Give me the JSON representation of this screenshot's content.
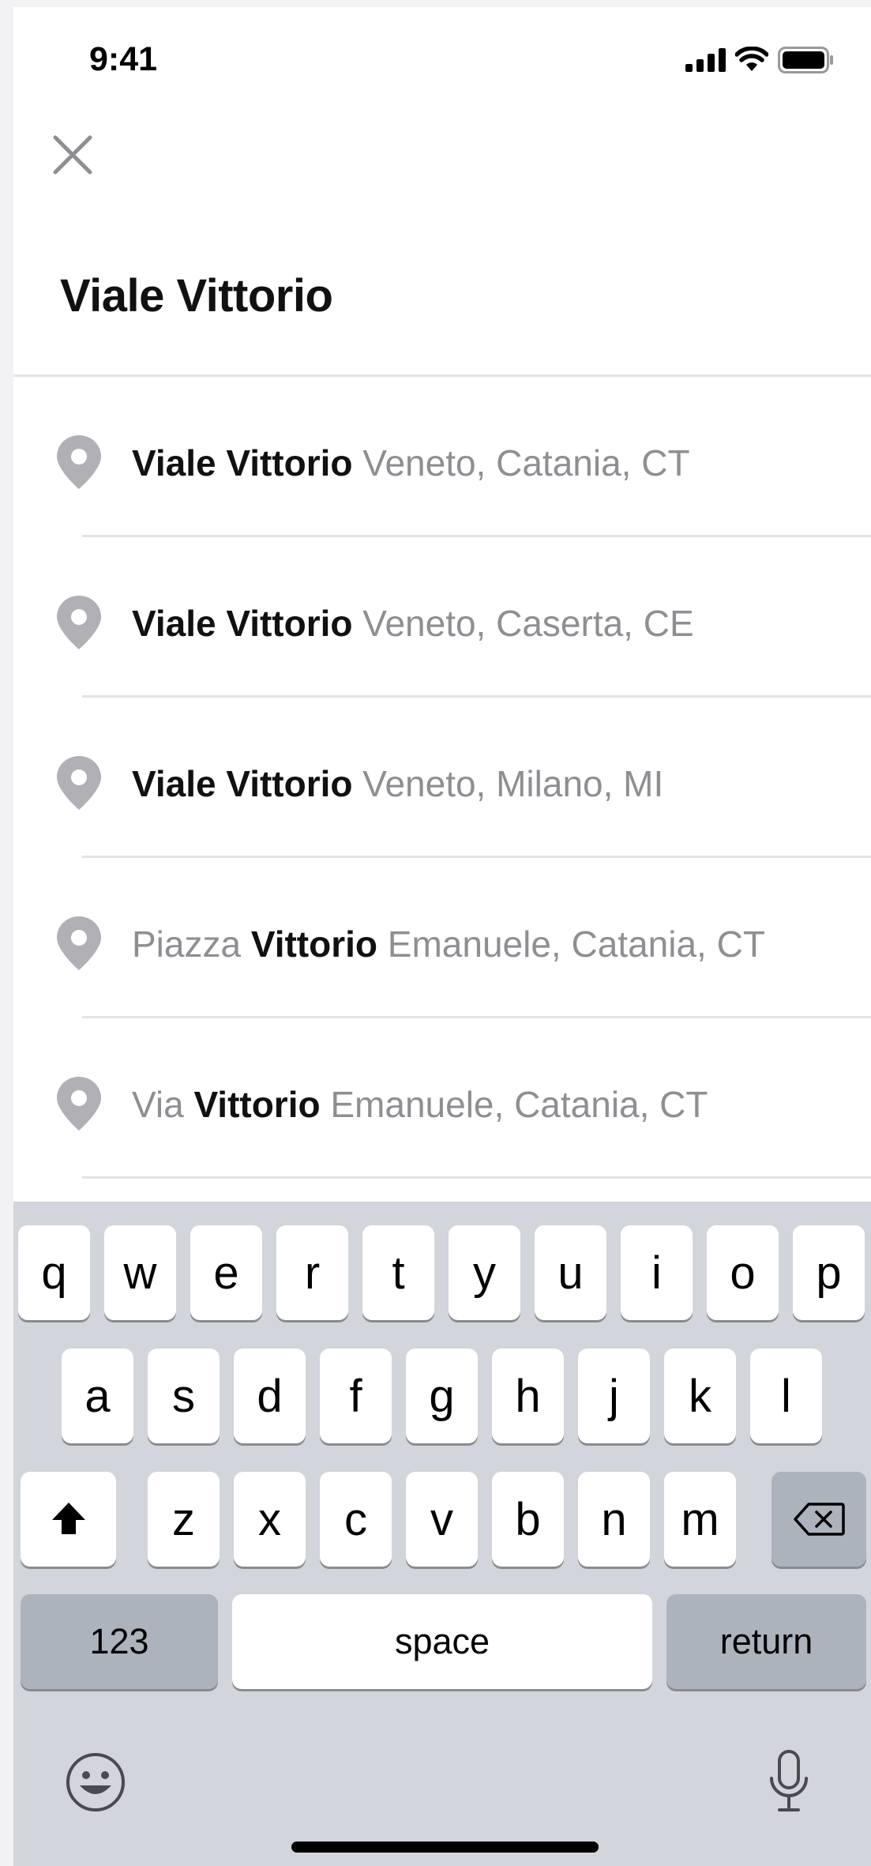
{
  "status_bar": {
    "time": "9:41"
  },
  "search": {
    "query": "Viale Vittorio"
  },
  "results": [
    {
      "prefix": "",
      "bold": "Viale Vittorio",
      "suffix": "Veneto, Catania, CT"
    },
    {
      "prefix": "",
      "bold": "Viale Vittorio",
      "suffix": "Veneto, Caserta, CE"
    },
    {
      "prefix": "",
      "bold": "Viale Vittorio",
      "suffix": "Veneto, Milano, MI"
    },
    {
      "prefix": "Piazza",
      "bold": "Vittorio",
      "suffix": "Emanuele, Catania, CT"
    },
    {
      "prefix": "Via",
      "bold": "Vittorio",
      "suffix": "Emanuele, Catania, CT"
    }
  ],
  "keyboard": {
    "row1": [
      "q",
      "w",
      "e",
      "r",
      "t",
      "y",
      "u",
      "i",
      "o",
      "p"
    ],
    "row2": [
      "a",
      "s",
      "d",
      "f",
      "g",
      "h",
      "j",
      "k",
      "l"
    ],
    "row3": [
      "z",
      "x",
      "c",
      "v",
      "b",
      "n",
      "m"
    ],
    "numbers_label": "123",
    "space_label": "space",
    "return_label": "return"
  },
  "colors": {
    "primary_text": "#111111",
    "secondary_text": "#8e8e93",
    "pin": "#b0b0b6",
    "keyboard_bg": "#d2d5db"
  },
  "icons": {
    "close": "close-icon",
    "pin": "location-pin-icon",
    "shift": "shift-icon",
    "delete": "delete-icon",
    "emoji": "emoji-icon",
    "mic": "microphone-icon"
  }
}
